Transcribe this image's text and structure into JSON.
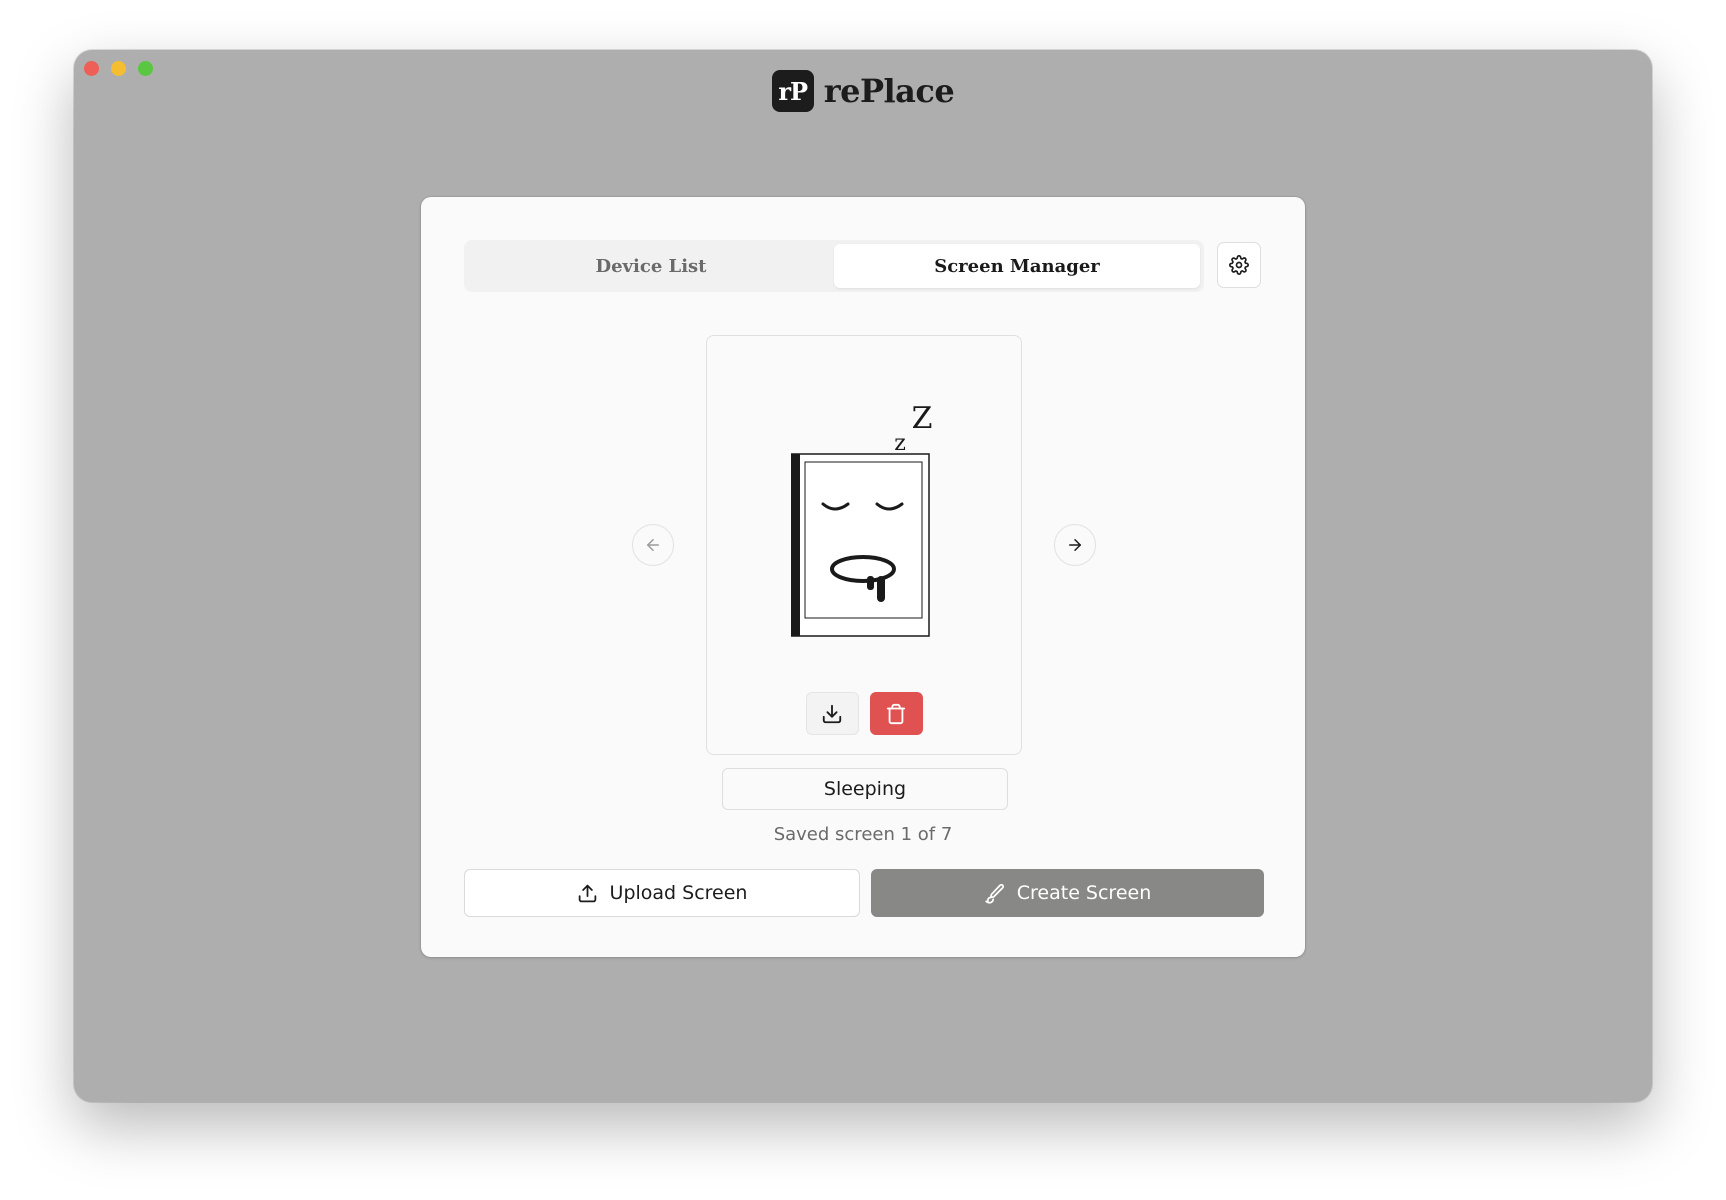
{
  "app": {
    "logo_text": "rP",
    "name": "rePlace"
  },
  "window": {
    "traffic_colors": [
      "#ee5f57",
      "#f5bd30",
      "#5ac740"
    ]
  },
  "tabs": [
    {
      "label": "Device List",
      "active": false
    },
    {
      "label": "Screen Manager",
      "active": true
    }
  ],
  "settings": {
    "icon": "gear-icon"
  },
  "preview": {
    "art": {
      "z_large": "Z",
      "z_small": "z"
    },
    "download_icon": "download-icon",
    "delete_icon": "trash-icon"
  },
  "navigation": {
    "prev_icon": "arrow-left-icon",
    "next_icon": "arrow-right-icon"
  },
  "screen_name": {
    "value": "Sleeping"
  },
  "status": {
    "text": "Saved screen 1 of 7"
  },
  "actions": {
    "upload": {
      "label": "Upload Screen",
      "icon": "upload-icon"
    },
    "create": {
      "label": "Create Screen",
      "icon": "brush-icon"
    }
  },
  "colors": {
    "accent_gray": "#888886",
    "danger": "#e05252",
    "window_bg": "#aeaeae"
  }
}
